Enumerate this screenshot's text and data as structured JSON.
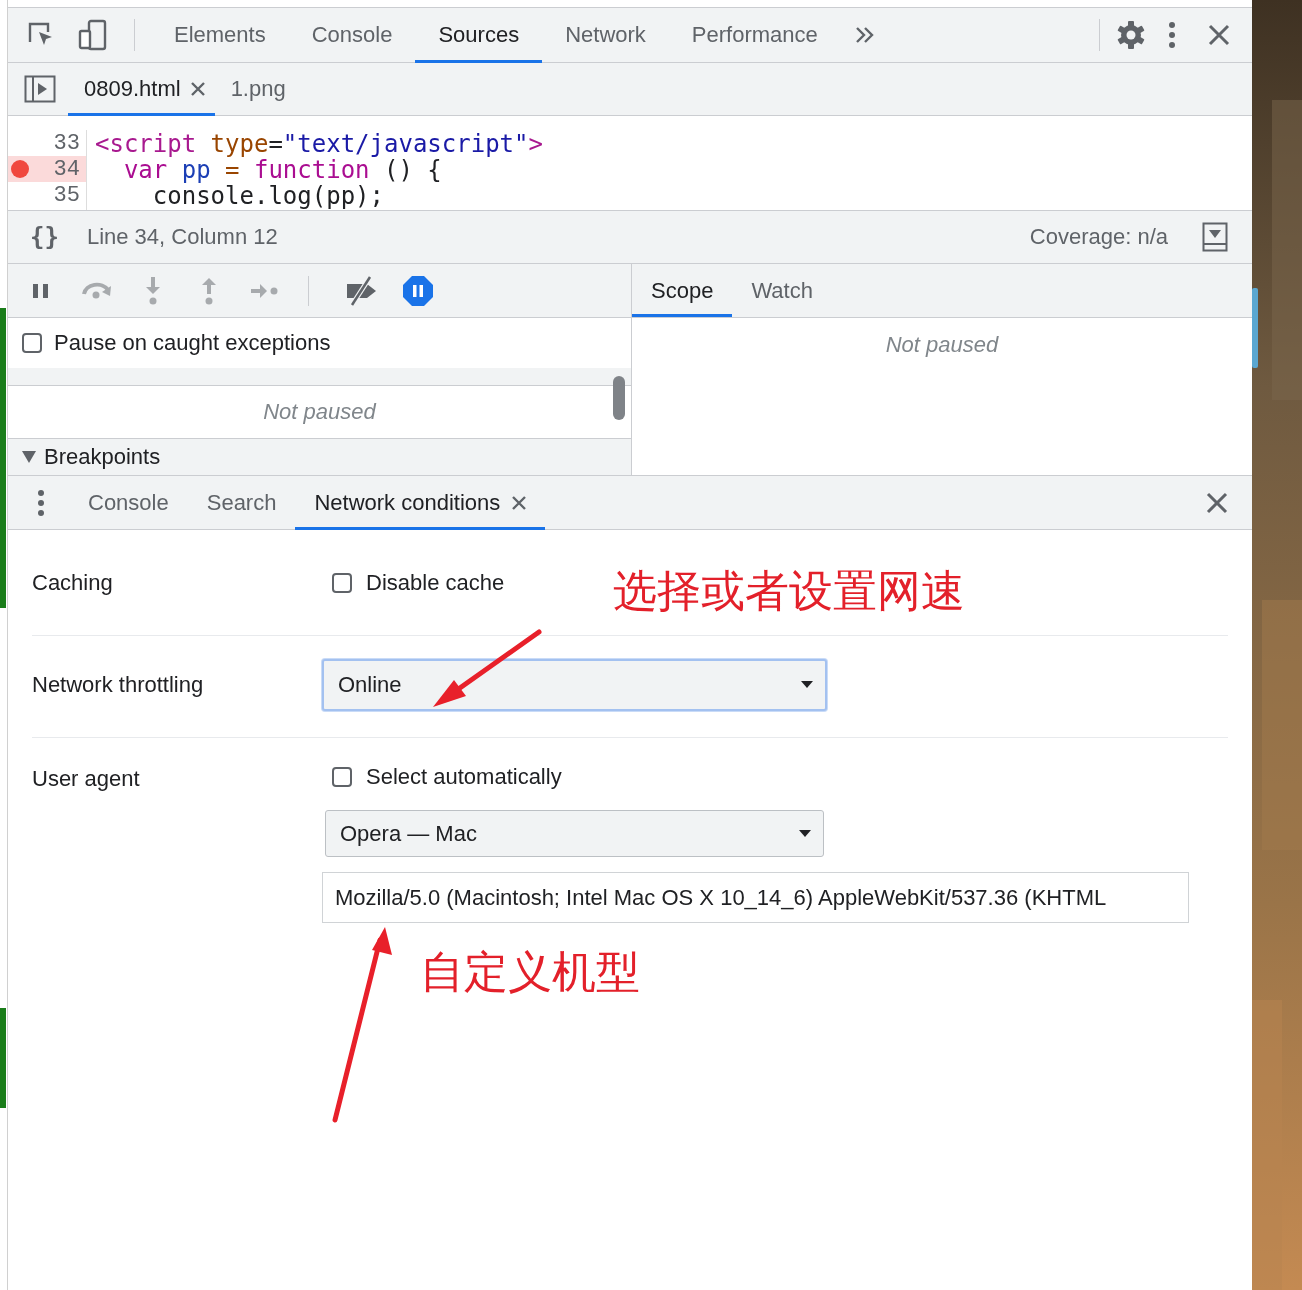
{
  "main_tabs": [
    {
      "label": "Elements",
      "selected": false
    },
    {
      "label": "Console",
      "selected": false
    },
    {
      "label": "Sources",
      "selected": true
    },
    {
      "label": "Network",
      "selected": false
    },
    {
      "label": "Performance",
      "selected": false
    }
  ],
  "file_tabs": [
    {
      "label": "0809.html",
      "selected": true,
      "closable": true
    },
    {
      "label": "1.png",
      "selected": false,
      "closable": false
    }
  ],
  "code_lines": [
    {
      "number": "33",
      "breakpoint": false,
      "tokens": [
        {
          "kind": "tag",
          "text": "<script"
        },
        {
          "kind": "attr",
          "text": " type"
        },
        {
          "kind": "plain",
          "text": "="
        },
        {
          "kind": "string",
          "text": "\"text/javascript\""
        },
        {
          "kind": "tag",
          "text": ">"
        }
      ]
    },
    {
      "number": "34",
      "breakpoint": true,
      "tokens": [
        {
          "kind": "keyword",
          "text": "  var"
        },
        {
          "kind": "def",
          "text": " pp"
        },
        {
          "kind": "operator",
          "text": " ="
        },
        {
          "kind": "keyword",
          "text": " function"
        },
        {
          "kind": "plain",
          "text": " () {"
        }
      ]
    },
    {
      "number": "35",
      "breakpoint": false,
      "tokens": [
        {
          "kind": "plain",
          "text": "    console.log(pp);"
        }
      ]
    }
  ],
  "status_bar": {
    "format_icon": "{}",
    "position": "Line 34, Column 12",
    "coverage": "Coverage: n/a"
  },
  "debugger_buttons": [
    {
      "kind": "pause",
      "disabled": false,
      "active": false
    },
    {
      "kind": "step-over",
      "disabled": true,
      "active": false
    },
    {
      "kind": "step-into",
      "disabled": true,
      "active": false
    },
    {
      "kind": "step-out",
      "disabled": true,
      "active": false
    },
    {
      "kind": "step",
      "disabled": true,
      "active": false
    },
    {
      "kind": "deactivate",
      "disabled": false,
      "active": false
    },
    {
      "kind": "pause-exceptions",
      "disabled": false,
      "active": true
    }
  ],
  "pause_on_caught": {
    "label": "Pause on caught exceptions",
    "checked": false
  },
  "call_stack": {
    "message": "Not paused"
  },
  "breakpoints": {
    "label": "Breakpoints",
    "expanded": true
  },
  "sidebar_tabs": [
    {
      "label": "Scope",
      "selected": true
    },
    {
      "label": "Watch",
      "selected": false
    }
  ],
  "scope": {
    "message": "Not paused"
  },
  "drawer_tabs": [
    {
      "label": "Console",
      "selected": false,
      "closable": false
    },
    {
      "label": "Search",
      "selected": false,
      "closable": false
    },
    {
      "label": "Network conditions",
      "selected": true,
      "closable": true
    }
  ],
  "network_conditions": {
    "caching": {
      "label": "Caching",
      "checkbox": {
        "label": "Disable cache",
        "checked": false
      }
    },
    "throttling": {
      "label": "Network throttling",
      "value": "Online",
      "focused": true
    },
    "user_agent": {
      "label": "User agent",
      "checkbox": {
        "label": "Select automatically",
        "checked": false
      },
      "preset": "Opera — Mac",
      "value": "Mozilla/5.0 (Macintosh; Intel Mac OS X 10_14_6) AppleWebKit/537.36 (KHTML"
    }
  },
  "annotations": [
    {
      "text": "选择或者设置网速"
    },
    {
      "text": "自定义机型"
    }
  ]
}
